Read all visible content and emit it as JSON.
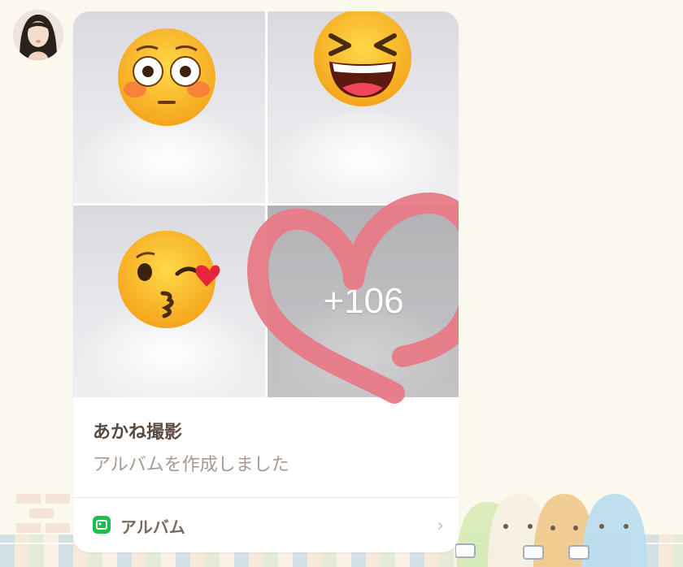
{
  "message": {
    "album_title": "あかね撮影",
    "album_subtitle": "アルバムを作成しました",
    "remaining_photos_label": "+106",
    "footer_label": "アルバム",
    "chevron": "›"
  },
  "photos": [
    {
      "emoji": "flushed-face-emoji"
    },
    {
      "emoji": "grinning-squinting-face-emoji"
    },
    {
      "emoji": "face-blowing-kiss-emoji"
    },
    {
      "emoji": "none"
    }
  ],
  "annotation": {
    "shape": "heart",
    "color": "#e87a87"
  },
  "colors": {
    "chat_background": "#fbf9ed",
    "card_background": "#ffffff",
    "title_text": "#5a4b40",
    "subtitle_text": "#a89a90",
    "album_icon": "#1bbf4c"
  }
}
